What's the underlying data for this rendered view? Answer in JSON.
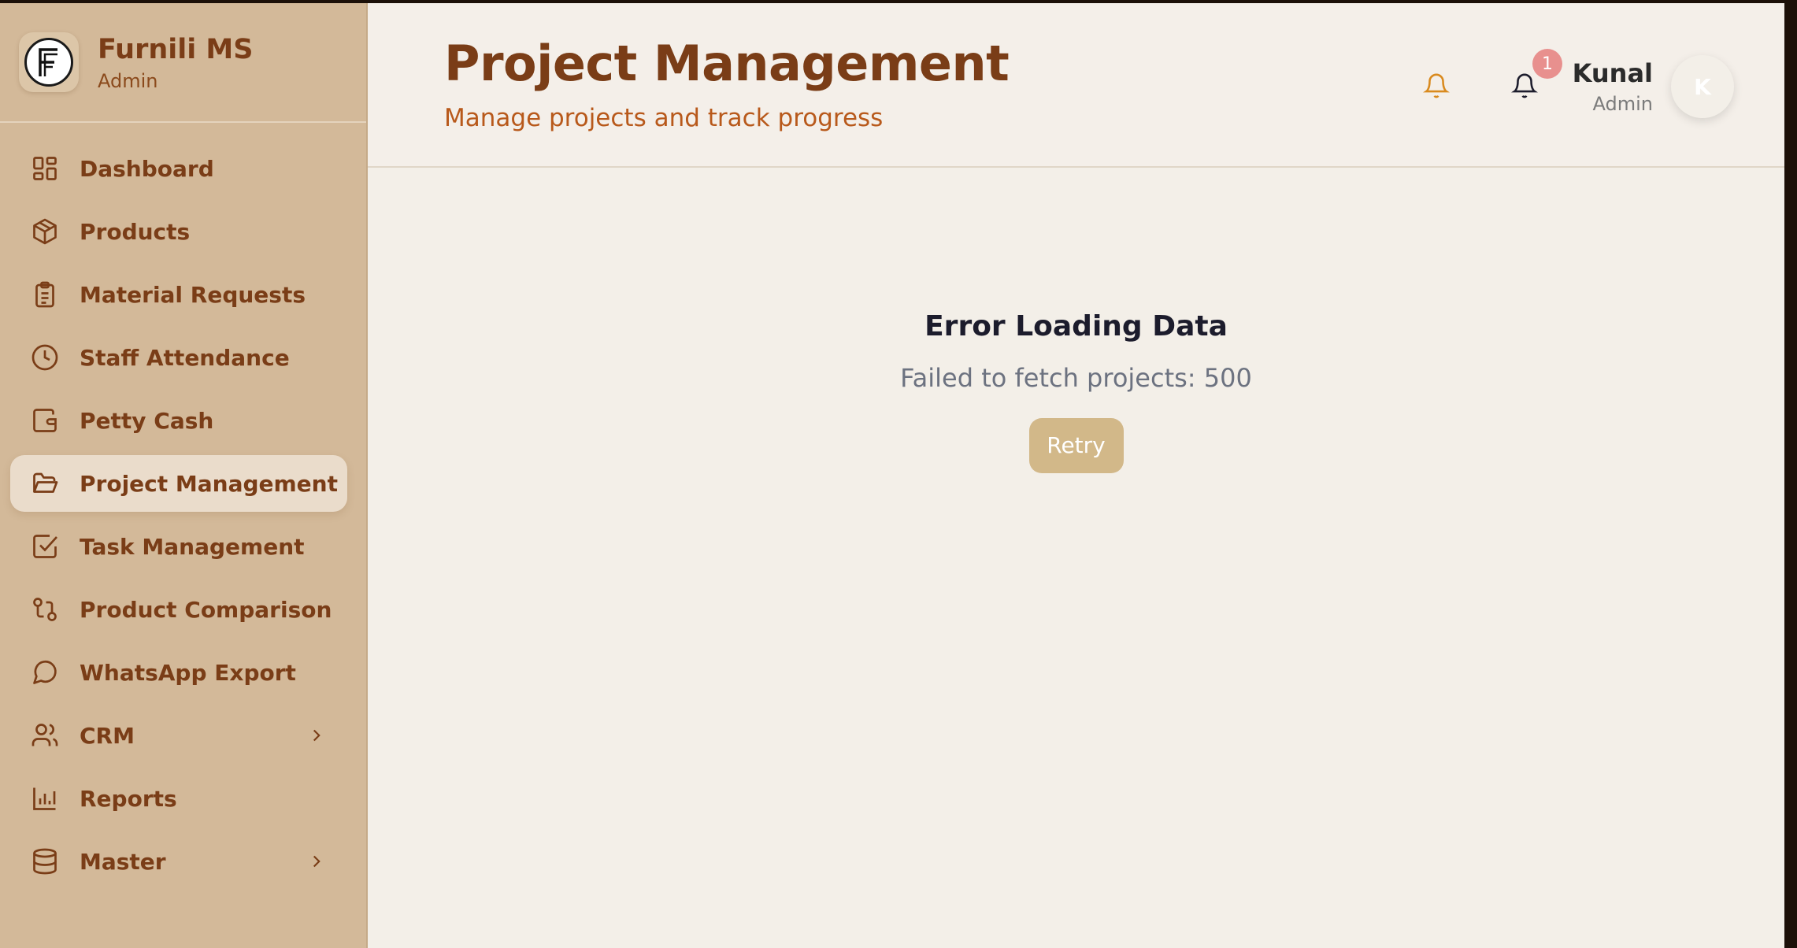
{
  "brand": {
    "name": "Furnili MS",
    "role": "Admin",
    "logo_letter": "F"
  },
  "sidebar": {
    "items": [
      {
        "label": "Dashboard",
        "icon": "dashboard-icon"
      },
      {
        "label": "Products",
        "icon": "box-icon"
      },
      {
        "label": "Material Requests",
        "icon": "clipboard-icon"
      },
      {
        "label": "Staff Attendance",
        "icon": "clock-icon"
      },
      {
        "label": "Petty Cash",
        "icon": "wallet-icon"
      },
      {
        "label": "Project Management",
        "icon": "folder-icon",
        "active": true
      },
      {
        "label": "Task Management",
        "icon": "checkbox-icon"
      },
      {
        "label": "Product Comparison",
        "icon": "compare-icon"
      },
      {
        "label": "WhatsApp Export",
        "icon": "chat-icon"
      },
      {
        "label": "CRM",
        "icon": "users-icon",
        "has_submenu": true
      },
      {
        "label": "Reports",
        "icon": "bar-chart-icon"
      },
      {
        "label": "Master",
        "icon": "database-icon",
        "has_submenu": true
      }
    ]
  },
  "header": {
    "title": "Project Management",
    "subtitle": "Manage projects and track progress",
    "notification_count": "1",
    "user": {
      "name": "Kunal",
      "role": "Admin",
      "initial": "K"
    }
  },
  "error": {
    "title": "Error Loading Data",
    "message": "Failed to fetch projects: 500",
    "retry_label": "Retry"
  },
  "colors": {
    "sidebar_bg": "#d3b999",
    "brand_brown": "#7a3d17",
    "subtitle_orange": "#b8591b",
    "retry_bg": "#d2b889",
    "badge": "#e8908e",
    "main_bg": "#f3efe8"
  }
}
